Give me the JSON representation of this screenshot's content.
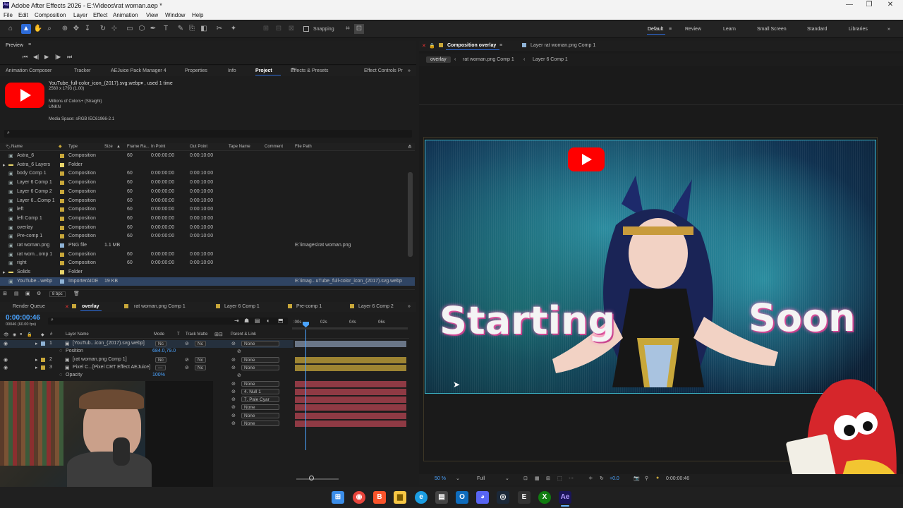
{
  "window": {
    "title": "Adobe After Effects 2026 - E:\\Videos\\rat woman.aep *",
    "app_badge": "Ae"
  },
  "menu": [
    "File",
    "Edit",
    "Composition",
    "Layer",
    "Effect",
    "Animation",
    "View",
    "Window",
    "Help"
  ],
  "toolbar": {
    "snapping_label": "Snapping",
    "workspaces": [
      "Default",
      "Review",
      "Learn",
      "Small Screen",
      "Standard",
      "Libraries"
    ],
    "active_workspace": "Default"
  },
  "preview_panel": {
    "title": "Preview"
  },
  "project_tabs": [
    "Animation Composer",
    "Tracker",
    "AEJuice Pack Manager 4",
    "Properties",
    "Info",
    "Project",
    "Effects & Presets",
    "Effect Controls Pr"
  ],
  "project_info": {
    "name": "YouTube_full-color_icon_(2017).svg.webp▾ , used 1 time",
    "dims": "2560 x 1793 (1.00)",
    "colors": "Millions of Colors+ (Straight)",
    "codec": "UNKN",
    "media_space": "Media Space: sRGB IEC61966-2.1"
  },
  "project_columns": [
    "Name",
    "Type",
    "Size",
    "Frame Ra...",
    "In Point",
    "Out Point",
    "Tape Name",
    "Comment",
    "File Path"
  ],
  "project_items": [
    {
      "name": "Astra_6",
      "type": "Composition",
      "size": "",
      "fps": "60",
      "in": "0:00:00:00",
      "out": "0:00:10:00",
      "path": "",
      "color": "#c8a73a"
    },
    {
      "name": "Astra_6 Layers",
      "type": "Folder",
      "size": "",
      "fps": "",
      "in": "",
      "out": "",
      "path": "",
      "color": "#e6d36a"
    },
    {
      "name": "body Comp 1",
      "type": "Composition",
      "size": "",
      "fps": "60",
      "in": "0:00:00:00",
      "out": "0:00:10:00",
      "path": "",
      "color": "#c8a73a"
    },
    {
      "name": "Layer 6 Comp 1",
      "type": "Composition",
      "size": "",
      "fps": "60",
      "in": "0:00:00:00",
      "out": "0:00:10:00",
      "path": "",
      "color": "#c8a73a"
    },
    {
      "name": "Layer 6 Comp 2",
      "type": "Composition",
      "size": "",
      "fps": "60",
      "in": "0:00:00:00",
      "out": "0:00:10:00",
      "path": "",
      "color": "#c8a73a"
    },
    {
      "name": "Layer 6...Comp 1",
      "type": "Composition",
      "size": "",
      "fps": "60",
      "in": "0:00:00:00",
      "out": "0:00:10:00",
      "path": "",
      "color": "#c8a73a"
    },
    {
      "name": "left",
      "type": "Composition",
      "size": "",
      "fps": "60",
      "in": "0:00:00:00",
      "out": "0:00:10:00",
      "path": "",
      "color": "#c8a73a"
    },
    {
      "name": "left Comp 1",
      "type": "Composition",
      "size": "",
      "fps": "60",
      "in": "0:00:00:00",
      "out": "0:00:10:00",
      "path": "",
      "color": "#c8a73a"
    },
    {
      "name": "overlay",
      "type": "Composition",
      "size": "",
      "fps": "60",
      "in": "0:00:00:00",
      "out": "0:00:10:00",
      "path": "",
      "color": "#c8a73a"
    },
    {
      "name": "Pre-comp 1",
      "type": "Composition",
      "size": "",
      "fps": "60",
      "in": "0:00:00:00",
      "out": "0:00:10:00",
      "path": "",
      "color": "#c8a73a"
    },
    {
      "name": "rat woman.png",
      "type": "PNG file",
      "size": "1.1 MB",
      "fps": "",
      "in": "",
      "out": "",
      "path": "E:\\images\\rat woman.png",
      "color": "#8fb3d6"
    },
    {
      "name": "rat wom...omp 1",
      "type": "Composition",
      "size": "",
      "fps": "60",
      "in": "0:00:00:00",
      "out": "0:00:10:00",
      "path": "",
      "color": "#c8a73a"
    },
    {
      "name": "right",
      "type": "Composition",
      "size": "",
      "fps": "60",
      "in": "0:00:00:00",
      "out": "0:00:10:00",
      "path": "",
      "color": "#c8a73a"
    },
    {
      "name": "Solids",
      "type": "Folder",
      "size": "",
      "fps": "",
      "in": "",
      "out": "",
      "path": "",
      "color": "#e6d36a"
    },
    {
      "name": "YouTube...webp",
      "type": "ImporterAIDE",
      "size": "19 KB",
      "fps": "",
      "in": "",
      "out": "",
      "path": "E:\\imag...uTube_full-color_icon_(2017).svg.webp",
      "color": "#8fb3d6"
    }
  ],
  "project_footer": {
    "bpc": "8 bpc"
  },
  "comp_panel": {
    "title": "Composition overlay",
    "other_tab": "Layer rat woman.png Comp 1",
    "breadcrumbs": [
      "overlay",
      "rat woman.png Comp 1",
      "Layer 6 Comp 1"
    ],
    "starting_text": "Starting",
    "soon_text": "Soon",
    "zoom": "50 %",
    "resolution": "Full",
    "exposure": "+0.0",
    "timecode": "0:00:00:46"
  },
  "timeline": {
    "tabs": [
      "Render Queue",
      "overlay",
      "rat woman.png Comp 1",
      "Layer 6 Comp 1",
      "Pre-comp 1",
      "Layer 6 Comp 2"
    ],
    "timecode": "0:00:00:46",
    "fps_note": "00046 (60.00 fps)",
    "columns": [
      "#",
      "Layer Name",
      "Mode",
      "T",
      "Track Matte",
      "Parent & Link"
    ],
    "ruler": [
      ":00s",
      "02s",
      "04s",
      "06s"
    ],
    "layers": [
      {
        "num": "1",
        "name": "[YouTub...icon_(2017).svg.webp]",
        "mode": "Nc",
        "matte": "Nc",
        "parent": "None",
        "color": "#8fb3d6"
      },
      {
        "num": "",
        "name": "Position",
        "value": "684.0,79.0",
        "prop": true
      },
      {
        "num": "2",
        "name": "[rat woman.png Comp 1]",
        "mode": "Nc",
        "matte": "Nc",
        "parent": "None",
        "color": "#c8a73a"
      },
      {
        "num": "3",
        "name": "Pixel C...[Pixel CRT Effect AEJuice]",
        "mode": "—",
        "matte": "Nc",
        "parent": "None",
        "color": "#c8a73a"
      },
      {
        "num": "",
        "name": "Opacity",
        "value": "100%",
        "prop": true
      },
      {
        "num": "",
        "name": "",
        "mode": "",
        "matte": "",
        "parent": "None",
        "color": "#b54452"
      },
      {
        "num": "",
        "name": "",
        "mode": "",
        "matte": "",
        "parent": "4. Null 1",
        "color": "#b54452"
      },
      {
        "num": "",
        "name": "",
        "mode": "",
        "matte": "",
        "parent": "7. Pale Cyar",
        "color": "#b54452"
      },
      {
        "num": "",
        "name": "",
        "mode": "",
        "matte": "",
        "parent": "None",
        "color": "#b54452"
      },
      {
        "num": "",
        "name": "",
        "mode": "",
        "matte": "",
        "parent": "None",
        "color": "#b54452"
      },
      {
        "num": "",
        "name": "",
        "mode": "",
        "matte": "",
        "parent": "None",
        "color": "#b54452"
      }
    ]
  },
  "taskbar_icons": [
    "windows-icon",
    "chrome-icon",
    "brave-icon",
    "explorer-icon",
    "edge-icon",
    "store-icon",
    "outlook-icon",
    "discord-icon",
    "steam-icon",
    "epic-icon",
    "xbox-icon",
    "after-effects-icon"
  ]
}
